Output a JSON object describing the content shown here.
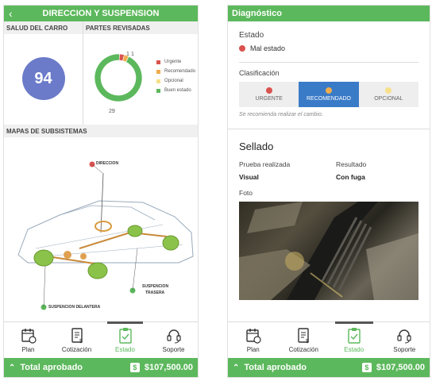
{
  "left": {
    "title": "DIRECCION Y SUSPENSION",
    "salud_header": "SALUD DEL CARRO",
    "salud_value": "94",
    "partes_header": "PARTES REVISADAS",
    "chart_data": {
      "type": "pie",
      "categories": [
        "Urgente",
        "Recomendado",
        "Opcional",
        "Buen estado"
      ],
      "values": [
        1,
        1,
        0,
        29
      ],
      "colors": [
        "#d9534f",
        "#f0ad4e",
        "#f7e08a",
        "#5cb85c"
      ],
      "legend_position": "right"
    },
    "slice_labels": {
      "urgente": "1",
      "recomendado": "1",
      "buen": "29"
    },
    "mapas_header": "MAPAS DE SUBSISTEMAS",
    "map_labels": {
      "direccion": "DIRECCION",
      "suspension_trasera_1": "SUSPENCION",
      "suspension_trasera_2": "TRASERA",
      "suspension_delantera": "SUSPENCION DELANTERA"
    }
  },
  "right": {
    "title": "Diagnóstico",
    "estado_label": "Estado",
    "estado_value": "Mal estado",
    "clasificacion_label": "Clasificación",
    "clasificacion_options": [
      {
        "label": "URGENTE",
        "color": "#d9534f"
      },
      {
        "label": "RECOMENDADO",
        "color": "#f0ad4e"
      },
      {
        "label": "OPCIONAL",
        "color": "#f7e08a"
      }
    ],
    "recommendation": "Se recomienda realizar el cambio.",
    "item_title": "Sellado",
    "prueba_label": "Prueba realizada",
    "prueba_value": "Visual",
    "resultado_label": "Resultado",
    "resultado_value": "Con fuga",
    "foto_label": "Foto"
  },
  "nav": [
    {
      "label": "Plan",
      "icon": "calendar-icon"
    },
    {
      "label": "Cotización",
      "icon": "invoice-icon"
    },
    {
      "label": "Estado",
      "icon": "clipboard-icon"
    },
    {
      "label": "Soporte",
      "icon": "headset-icon"
    }
  ],
  "total": {
    "label": "Total aprobado",
    "currency_icon": "$",
    "amount": "$107,500.00"
  },
  "colors": {
    "green": "#5cb85c",
    "blue": "#3a7bc8",
    "health_circle": "#6b7bc9"
  }
}
